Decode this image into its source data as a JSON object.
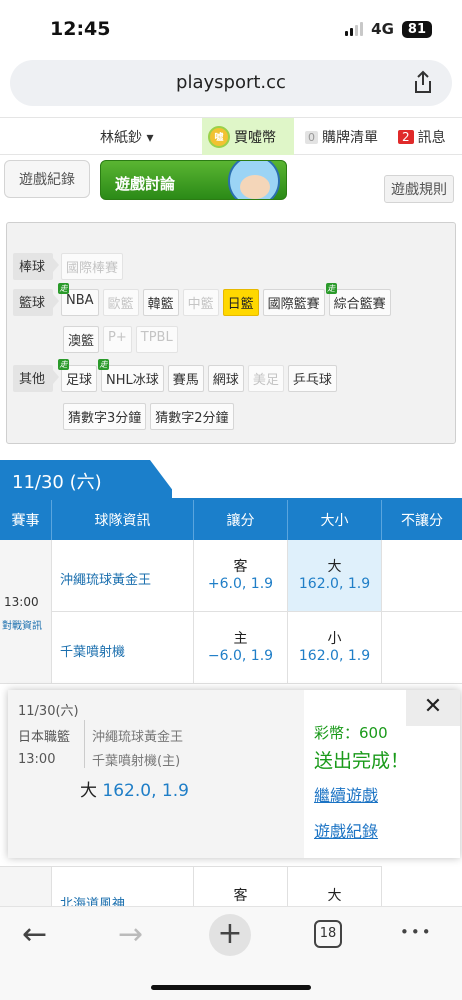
{
  "status": {
    "time": "12:45",
    "network": "4G",
    "battery": "81"
  },
  "browser": {
    "url": "playsport.cc",
    "share_icon": "share-icon"
  },
  "topnav": {
    "user": "林紙鈔 ▾",
    "coin_icon": "coin-icon",
    "buy": "買噓幣",
    "cart_count": "0",
    "cart": "購牌清單",
    "msg_count": "2",
    "msg": "訊息"
  },
  "tabs": {
    "record": "遊戲紀錄",
    "discuss": "遊戲討論",
    "rules": "遊戲規則"
  },
  "categories": {
    "baseball": {
      "label": "棒球",
      "items": [
        "國際棒賽"
      ]
    },
    "basketball": {
      "label": "籃球",
      "items": [
        "NBA",
        "歐籃",
        "韓籃",
        "中籃",
        "日籃",
        "國際籃賽",
        "綜合籃賽",
        "澳籃",
        "P+",
        "TPBL"
      ]
    },
    "other": {
      "label": "其他",
      "items": [
        "足球",
        "NHL冰球",
        "賽馬",
        "網球",
        "美足",
        "乒乓球",
        "猜數字3分鐘",
        "猜數字2分鐘"
      ]
    },
    "running_badge": "走"
  },
  "date": "11/30 (六)",
  "table": {
    "headers": [
      "賽事",
      "球隊資訊",
      "讓分",
      "大小",
      "不讓分"
    ],
    "match": {
      "time": "13:00",
      "info_link": "對戰資訊",
      "away": "沖繩琉球黃金王",
      "home": "千葉噴射機",
      "spread_away_label": "客",
      "spread_away_val": "+6.0, 1.9",
      "spread_home_label": "主",
      "spread_home_val": "−6.0, 1.9",
      "total_over_label": "大",
      "total_over_val": "162.0, 1.9",
      "total_under_label": "小",
      "total_under_val": "162.0, 1.9"
    },
    "next_match": {
      "away": "北海道風神",
      "spread_label": "客",
      "total_label": "大"
    }
  },
  "popup": {
    "date": "11/30(六)",
    "league": "日本職籃",
    "time": "13:00",
    "team_away": "沖繩琉球黃金王",
    "team_home": "千葉噴射機(主)",
    "pick_label": "大",
    "pick_val": "162.0, 1.9",
    "coins": "彩幣：600",
    "done": "送出完成！",
    "continue": "繼續遊戲",
    "record": "遊戲紀錄",
    "close": "✕"
  },
  "bottom": {
    "back": "←",
    "forward": "→",
    "new_tab": "+",
    "tabs_count": "18",
    "more": "•••"
  },
  "colors": {
    "accent": "#1b7fcb",
    "green": "#2b8a17",
    "selected": "#ffd800",
    "done_green": "#1a9a1a"
  }
}
